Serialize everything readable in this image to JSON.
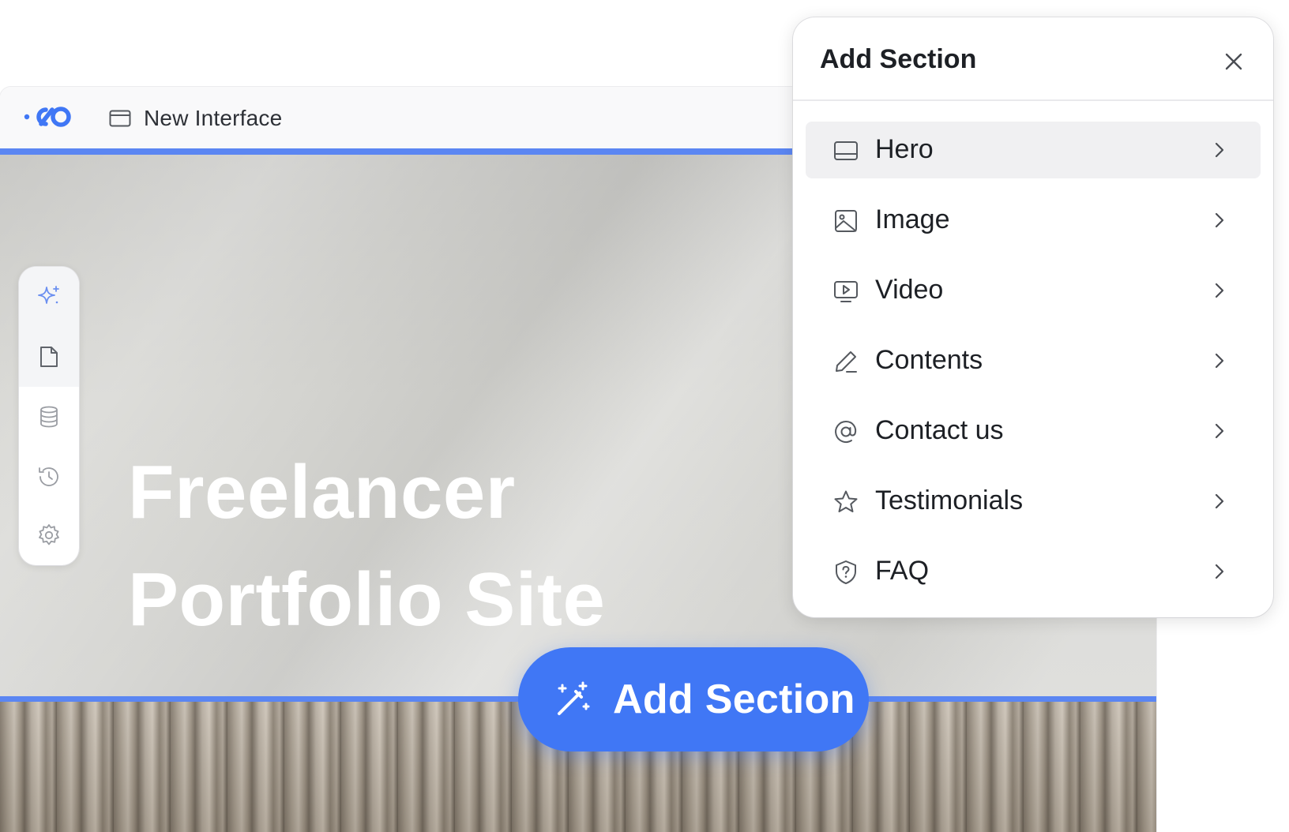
{
  "editor": {
    "document_title": "New Interface",
    "hero_title_line1": "Freelancer",
    "hero_title_line2": "Portfolio Site"
  },
  "rail": {
    "items": [
      {
        "icon": "sparkle-icon",
        "active": true
      },
      {
        "icon": "page-icon",
        "active": true
      },
      {
        "icon": "database-icon",
        "active": false
      },
      {
        "icon": "history-icon",
        "active": false
      },
      {
        "icon": "gear-icon",
        "active": false
      }
    ]
  },
  "add_section_button": {
    "label": "Add Section",
    "icon": "magic-wand-icon"
  },
  "panel": {
    "title": "Add Section",
    "close_icon": "close-icon",
    "items": [
      {
        "label": "Hero",
        "icon": "hero-icon",
        "active": true
      },
      {
        "label": "Image",
        "icon": "image-icon",
        "active": false
      },
      {
        "label": "Video",
        "icon": "video-icon",
        "active": false
      },
      {
        "label": "Contents",
        "icon": "pencil-icon",
        "active": false
      },
      {
        "label": "Contact us",
        "icon": "at-sign-icon",
        "active": false
      },
      {
        "label": "Testimonials",
        "icon": "star-icon",
        "active": false
      },
      {
        "label": "FAQ",
        "icon": "shield-question-icon",
        "active": false
      }
    ]
  },
  "colors": {
    "accent": "#4077f5",
    "line_accent": "#5b86f2",
    "sparkle": "#6b8ff0",
    "hero_text": "#ffffff"
  }
}
